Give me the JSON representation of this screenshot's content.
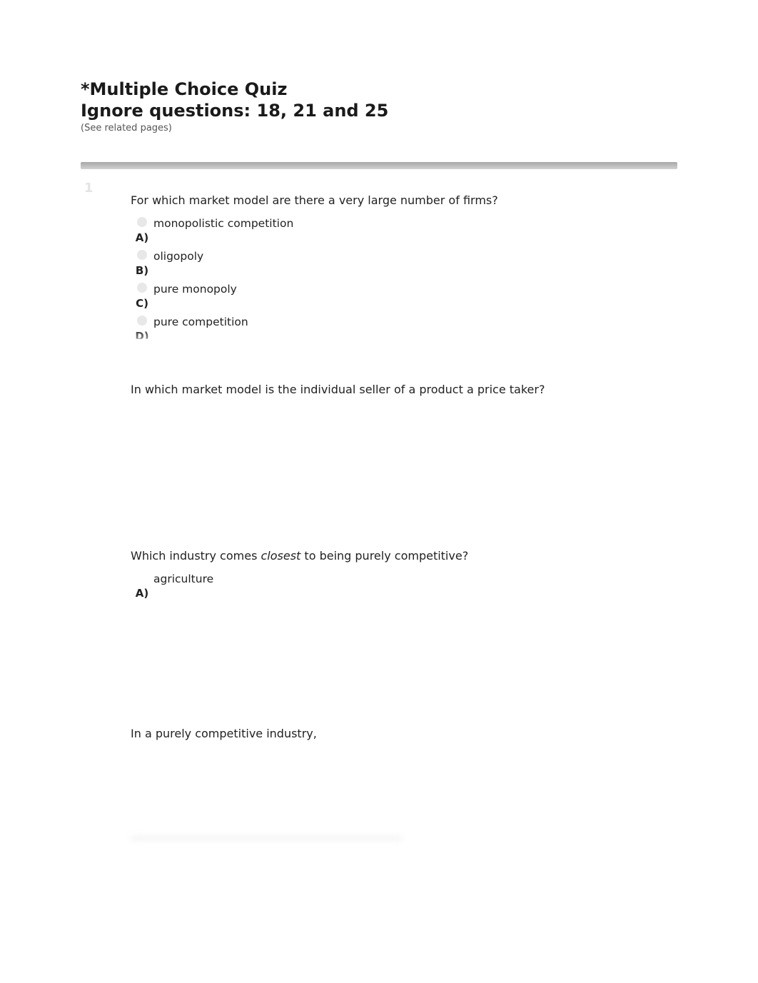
{
  "header": {
    "title_line1": "*Multiple Choice Quiz",
    "title_line2": "Ignore questions: 18, 21 and 25",
    "subtitle": "(See related pages)"
  },
  "q1": {
    "number": "1",
    "text": "For which market model are there a very large number of firms?",
    "opts": [
      {
        "label": "A)",
        "text": "monopolistic competition"
      },
      {
        "label": "B)",
        "text": "oligopoly"
      },
      {
        "label": "C)",
        "text": "pure monopoly"
      },
      {
        "label": "D)",
        "text": "pure competition"
      }
    ]
  },
  "q2": {
    "text": "In which market model is the individual seller of a product a price taker?"
  },
  "q3": {
    "text_pre": "Which industry comes",
    "text_em": "closest",
    "text_post": "to being purely competitive?",
    "opts": [
      {
        "label": "A)",
        "text": "agriculture"
      }
    ]
  },
  "q4": {
    "text": "In a purely competitive industry,"
  }
}
